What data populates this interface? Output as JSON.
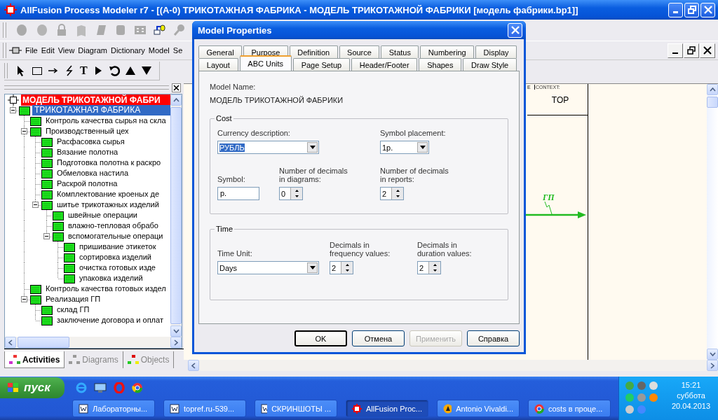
{
  "window": {
    "title": "AllFusion Process Modeler r7 - [(A-0) ТРИКОТАЖНАЯ ФАБРИКА - МОДЕЛЬ ТРИКОТАЖНОЙ ФАБРИКИ  [модель фабрики.bp1]]"
  },
  "menu": [
    "File",
    "Edit",
    "View",
    "Diagram",
    "Dictionary",
    "Model",
    "Se"
  ],
  "text_tool": "T",
  "tree": {
    "root": "МОДЕЛЬ ТРИКОТАЖНОЙ ФАБРИ",
    "nodes": [
      {
        "label": "ТРИКОТАЖНАЯ ФАБРИКА",
        "selected": true,
        "expanded": true,
        "children": [
          {
            "label": "Контроль качества  сырья на скла",
            "selected": false
          },
          {
            "label": "Производственный цех",
            "selected": false,
            "expanded": true,
            "children": [
              {
                "label": "Расфасовка  сырья",
                "selected": false
              },
              {
                "label": "Вязание  полотна",
                "selected": false
              },
              {
                "label": "Подготовка  полотна к раскро",
                "selected": false
              },
              {
                "label": "Обмеловка  настила",
                "selected": false
              },
              {
                "label": "Раскрой полотна",
                "selected": false
              },
              {
                "label": "Комплектование  кроеных   де",
                "selected": false
              },
              {
                "label": "шитье  трикотажных  изделий",
                "selected": false,
                "expanded": true,
                "children": [
                  {
                    "label": "швейные операции",
                    "selected": false
                  },
                  {
                    "label": "влажно-тепловая    обрабо",
                    "selected": false
                  },
                  {
                    "label": "вспомогательные  операци",
                    "selected": false,
                    "expanded": true,
                    "children": [
                      {
                        "label": "пришивание  этикеток",
                        "selected": false
                      },
                      {
                        "label": "сортировка  изделий",
                        "selected": false
                      },
                      {
                        "label": "очистка готовых     изде",
                        "selected": false
                      },
                      {
                        "label": "упаковка изделий",
                        "selected": false
                      }
                    ]
                  }
                ]
              }
            ]
          },
          {
            "label": "Контроль качества  готовых издел",
            "selected": false
          },
          {
            "label": "Реализация ГП",
            "selected": false,
            "expanded": true,
            "children": [
              {
                "label": "склад ГП",
                "selected": false
              },
              {
                "label": "заключение договора  и оплат",
                "selected": false
              }
            ]
          }
        ]
      }
    ]
  },
  "panel_tabs": [
    {
      "label": "Activities",
      "selected": true
    },
    {
      "label": "Diagrams",
      "selected": false
    },
    {
      "label": "Objects",
      "selected": false
    }
  ],
  "diagram": {
    "fragment": "E",
    "context_label": "CONTEXT:",
    "context_value": "TOP",
    "arrow_label": "ГП"
  },
  "dialog": {
    "title": "Model Properties",
    "tabs_row1": [
      {
        "label": "General",
        "selected": false
      },
      {
        "label": "Purpose",
        "selected": false
      },
      {
        "label": "Definition",
        "selected": false
      },
      {
        "label": "Source",
        "selected": false
      },
      {
        "label": "Status",
        "selected": false
      },
      {
        "label": "Numbering",
        "selected": false
      },
      {
        "label": "Display",
        "selected": false
      }
    ],
    "tabs_row2": [
      {
        "label": "Layout",
        "selected": false
      },
      {
        "label": "ABC Units",
        "selected": true
      },
      {
        "label": "Page Setup",
        "selected": false
      },
      {
        "label": "Header/Footer",
        "selected": false
      },
      {
        "label": "Shapes",
        "selected": false
      },
      {
        "label": "Draw Style",
        "selected": false
      }
    ],
    "model_name_label": "Model Name:",
    "model_name_value": "МОДЕЛЬ ТРИКОТАЖНОЙ ФАБРИКИ",
    "cost": {
      "title": "Cost",
      "currency": {
        "label": "Currency description:",
        "value": "РУБЛЬ",
        "focused": true
      },
      "placement": {
        "label": "Symbol placement:",
        "value": "1р."
      },
      "symbol": {
        "label": "Symbol:",
        "value": "р."
      },
      "decimals_diagrams": {
        "label": "Number of decimals in diagrams:",
        "value": "0"
      },
      "decimals_reports": {
        "label": "Number of decimals in reports:",
        "value": "2"
      }
    },
    "time": {
      "title": "Time",
      "unit": {
        "label": "Time Unit:",
        "value": "Days"
      },
      "frequency": {
        "label": "Decimals in frequency values:",
        "value": "2"
      },
      "duration": {
        "label": "Decimals in duration values:",
        "value": "2"
      }
    },
    "buttons": [
      {
        "label": "OK",
        "default": true,
        "disabled": false
      },
      {
        "label": "Отмена",
        "default": false,
        "disabled": false
      },
      {
        "label": "Применить",
        "default": false,
        "disabled": true
      },
      {
        "label": "Справка",
        "default": false,
        "disabled": false
      }
    ]
  },
  "taskbar": {
    "start": "пуск",
    "tasks": [
      {
        "label": "Лабораторны...",
        "kind": "document",
        "selected": false
      },
      {
        "label": "topref.ru-539...",
        "kind": "document",
        "selected": false
      },
      {
        "label": "СКРИНШОТЫ ...",
        "kind": "document",
        "selected": false
      },
      {
        "label": "AllFusion Proc...",
        "kind": "modeler",
        "selected": true
      },
      {
        "label": "Antonio Vivaldi...",
        "kind": "player",
        "selected": false
      },
      {
        "label": "costs в проце...",
        "kind": "browser",
        "selected": false
      }
    ],
    "clock": {
      "time": "15:21",
      "day": "суббота",
      "date": "20.04.2013"
    }
  }
}
